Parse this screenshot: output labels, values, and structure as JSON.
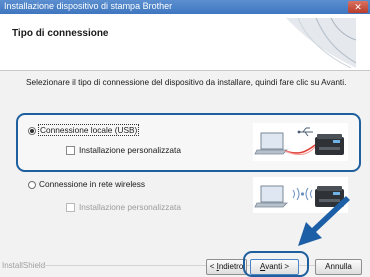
{
  "window": {
    "title": "Installazione dispositivo di stampa Brother",
    "close_glyph": "✕"
  },
  "header": {
    "title": "Tipo di connessione"
  },
  "instruction": "Selezionare il tipo di connessione del dispositivo da installare, quindi fare clic su Avanti.",
  "options": [
    {
      "label": "Connessione locale (USB)",
      "selected": true,
      "sub_label": "Installazione personalizzata",
      "sub_enabled": true,
      "icon": "usb-connection-illustration"
    },
    {
      "label": "Connessione in rete wireless",
      "selected": false,
      "sub_label": "Installazione personalizzata",
      "sub_enabled": false,
      "icon": "wireless-connection-illustration"
    }
  ],
  "footer": {
    "brand": "InstallShield",
    "back_prefix": "< ",
    "back_mnemonic": "I",
    "back_rest": "ndietro",
    "next_mnemonic": "A",
    "next_rest": "vanti >",
    "cancel_label": "Annulla"
  },
  "colors": {
    "title_bar": "#3f76bf",
    "highlight": "#1f5f9e",
    "arrow": "#1c5fa6"
  }
}
